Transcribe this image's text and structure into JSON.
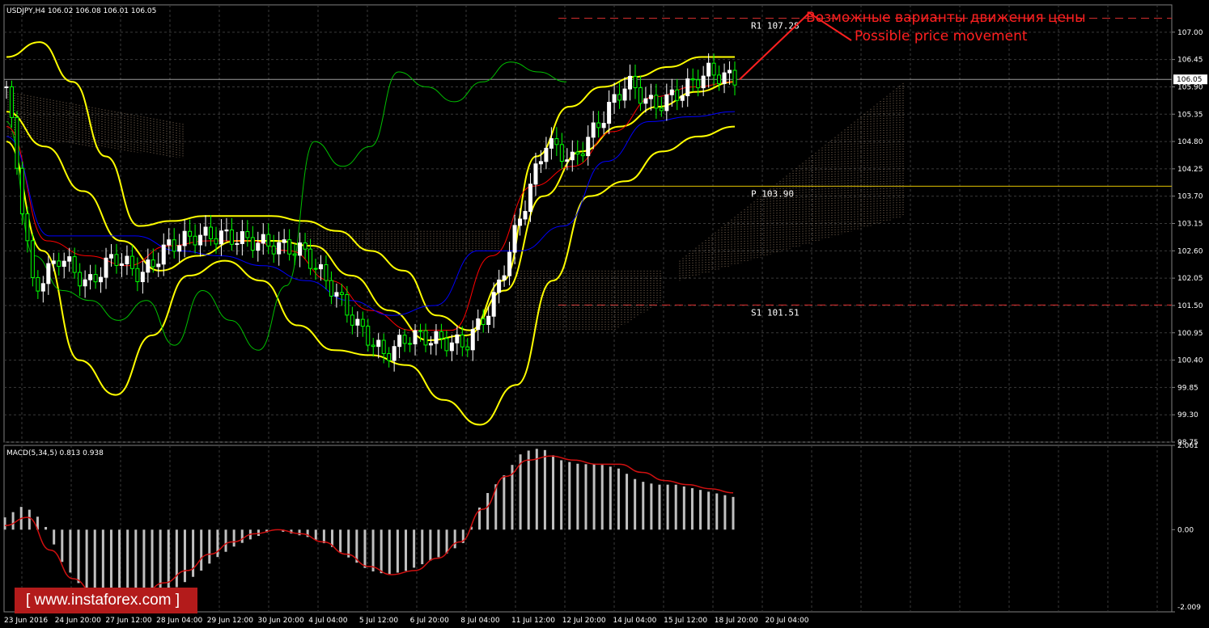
{
  "chart_data": {
    "type": "candlestick",
    "symbol_header": "USDJPY,H4  106.02 106.08 106.01 106.05",
    "price_axis": {
      "ylim": [
        98.75,
        107.55
      ],
      "ticks": [
        "107.00",
        "106.45",
        "105.90",
        "105.35",
        "104.80",
        "104.25",
        "103.70",
        "103.15",
        "102.60",
        "102.05",
        "101.50",
        "100.95",
        "100.40",
        "99.85",
        "99.30",
        "98.75"
      ],
      "current_price": "106.05"
    },
    "time_axis": {
      "labels": [
        "23 Jun 2016",
        "24 Jun 20:00",
        "27 Jun 12:00",
        "28 Jun 04:00",
        "29 Jun 12:00",
        "30 Jun 20:00",
        "4 Jul 04:00",
        "5 Jul 12:00",
        "6 Jul 20:00",
        "8 Jul 04:00",
        "11 Jul 12:00",
        "12 Jul 20:00",
        "14 Jul 04:00",
        "15 Jul 12:00",
        "18 Jul 20:00",
        "20 Jul 04:00"
      ]
    },
    "close_series": [
      105.9,
      101.8,
      102.5,
      101.9,
      102.5,
      102.1,
      102.7,
      102.9,
      102.9,
      102.8,
      102.7,
      102.6,
      101.9,
      101.1,
      100.5,
      100.9,
      100.8,
      100.7,
      101.5,
      103.2,
      104.8,
      104.4,
      105.2,
      106.0,
      105.5,
      105.8,
      106.2,
      106.05
    ],
    "upper_band": [
      106.5,
      106.8,
      106.0,
      104.5,
      103.1,
      103.2,
      103.3,
      103.3,
      103.3,
      103.2,
      103.0,
      102.6,
      102.2,
      101.3,
      101.0,
      102.0,
      104.5,
      105.5,
      105.9,
      106.1,
      106.3,
      106.5,
      106.5
    ],
    "middle_band": [
      105.4,
      104.7,
      103.8,
      102.8,
      102.2,
      102.5,
      102.8,
      102.8,
      102.7,
      102.1,
      101.4,
      100.8,
      100.9,
      101.8,
      103.7,
      104.6,
      105.1,
      105.5,
      105.8,
      106.0
    ],
    "lower_band": [
      104.8,
      102.6,
      100.4,
      99.7,
      100.9,
      102.1,
      102.4,
      102.0,
      101.1,
      100.6,
      100.5,
      100.3,
      99.6,
      99.1,
      99.9,
      102.0,
      103.7,
      104.0,
      104.6,
      104.9,
      105.1
    ],
    "levels": [
      {
        "label": "R1 107.28",
        "value": 107.28,
        "color": "#e03030"
      },
      {
        "label": "P 103.90",
        "value": 103.9,
        "color": "#e0c000"
      },
      {
        "label": "S1 101.51",
        "value": 101.51,
        "color": "#e03030"
      }
    ],
    "annotations": [
      "Возможные варианты движения цены",
      "Possible price movement"
    ],
    "macd": {
      "title": "MACD(5,34,5) 0.813 0.938",
      "ticks": [
        "2.061",
        "0.00",
        "-2.009"
      ],
      "ylim": [
        -2.009,
        2.061
      ],
      "histogram": [
        0.3,
        0.6,
        0.2,
        -0.8,
        -1.4,
        -1.6,
        -1.7,
        -1.7,
        -1.6,
        -1.4,
        -1.1,
        -0.7,
        -0.4,
        -0.2,
        0.0,
        -0.1,
        -0.2,
        -0.4,
        -0.7,
        -1.0,
        -1.1,
        -1.0,
        -0.8,
        -0.6,
        -0.3,
        0.8,
        1.3,
        1.9,
        2.0,
        1.7,
        1.6,
        1.6,
        1.5,
        1.2,
        1.1,
        1.1,
        1.0,
        0.9,
        0.8
      ],
      "signal": [
        0.1,
        0.3,
        -0.5,
        -1.2,
        -1.6,
        -1.7,
        -1.6,
        -1.3,
        -1.0,
        -0.6,
        -0.3,
        -0.1,
        0.0,
        -0.1,
        -0.3,
        -0.6,
        -0.9,
        -1.1,
        -1.0,
        -0.7,
        -0.3,
        0.5,
        1.3,
        1.7,
        1.8,
        1.7,
        1.6,
        1.6,
        1.4,
        1.2,
        1.1,
        1.0,
        0.9
      ]
    }
  },
  "brand": {
    "text": "[ www.instaforex.com ]"
  },
  "colors": {
    "up": "#ffffff",
    "down": "#00ff00",
    "band": "#ffff00",
    "tenkan": "#ff0000",
    "kijun": "#0000ff",
    "chikou": "#00c000"
  }
}
